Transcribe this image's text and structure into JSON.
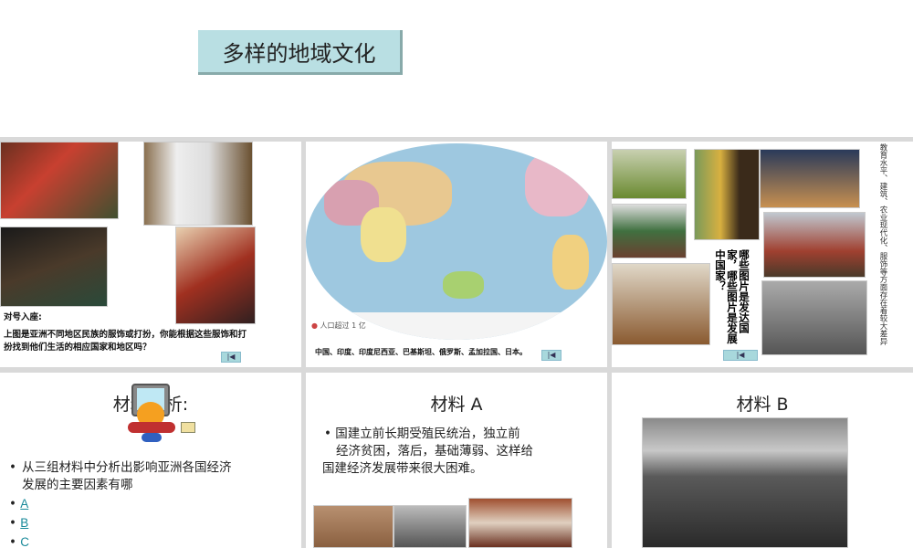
{
  "slide1": {
    "title": "多样的地域文化"
  },
  "slide2": {
    "heading": "对号入座:",
    "text": "上图是亚洲不同地区民族的服饰或打扮，你能根据这些服饰和打扮找到他们生活的相应国家和地区吗？",
    "nav": "|◀"
  },
  "slide3": {
    "legend": "人口超过 1 亿",
    "countries": "中国、印度、印度尼西亚、巴基斯坦、俄罗斯、孟加拉国、日本。",
    "nav": "|◀"
  },
  "slide4": {
    "question": "哪些图片是发达国家，哪些图片是发展中国家？",
    "side_text": "教育水平、建筑、农业现代化、服饰等方面存在着较大差异",
    "nav": "|◀"
  },
  "slide5": {
    "title": "材料分析:",
    "bullet": "从三组材料中分析出影响亚洲各国经济发展的主要因素有哪",
    "links": [
      "A",
      "B",
      "C"
    ]
  },
  "slide6": {
    "title": "材料 A",
    "text_line1": "国建立前长期受殖民统治，独立前",
    "text_line2": "经济贫困，落后，基础薄弱、这样给",
    "text_line3": "国建经济发展带来很大困难。"
  },
  "slide7": {
    "title": "材料 B"
  }
}
